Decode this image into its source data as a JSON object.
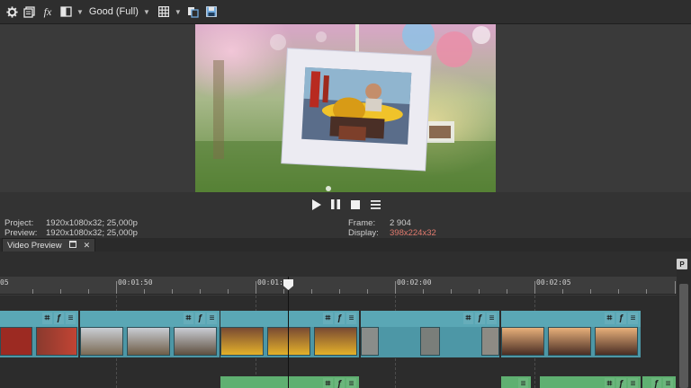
{
  "toolbar": {
    "items": [
      {
        "name": "settings-gear-icon"
      },
      {
        "name": "preview-options-icon"
      },
      {
        "name": "video-fx-icon",
        "label": "fx"
      },
      {
        "name": "split-screen-icon"
      }
    ],
    "quality_label": "Good (Full)",
    "overlay_icon": "grid-icon",
    "copy_snapshot_icon": "copy-snapshot-icon",
    "save_snapshot_icon": "save-snapshot-icon"
  },
  "info": {
    "project_label": "Project:",
    "project_value": "1920x1080x32; 25,000p",
    "preview_label": "Preview:",
    "preview_value": "1920x1080x32; 25,000p",
    "frame_label": "Frame:",
    "frame_value": "2 904",
    "display_label": "Display:",
    "display_value": "398x224x32"
  },
  "tab": {
    "label": "Video Preview"
  },
  "ruler": {
    "labels": [
      "05",
      "00:01:50",
      "00:01:55",
      "00:02:00",
      "00:02:05"
    ]
  },
  "marker_button": "P",
  "colors": {
    "video_clip": "#4d97a6",
    "audio_clip": "#5fb071",
    "display_value": "#e07a6e"
  }
}
